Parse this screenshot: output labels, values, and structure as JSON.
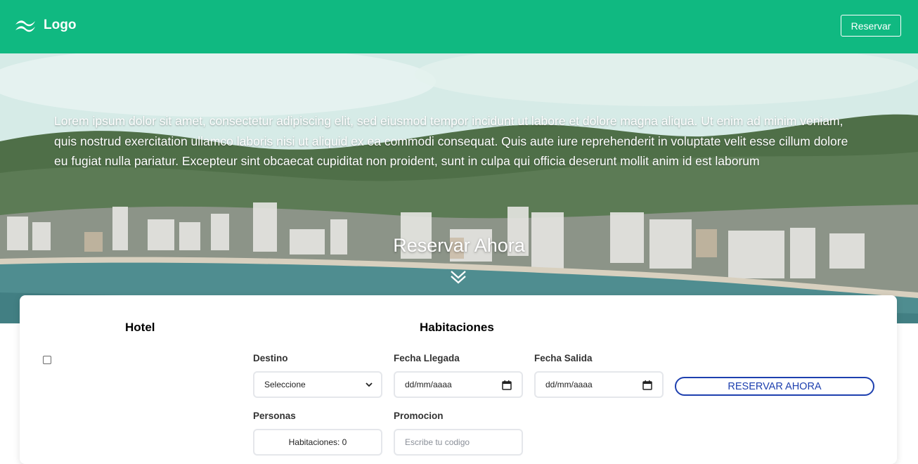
{
  "header": {
    "logo_text": "Logo",
    "reserve_button": "Reservar",
    "background_color": "#10b981"
  },
  "hero": {
    "paragraph": "Lorem ipsum dolor sit amet, consectetur adipiscing elit, sed eiusmod tempor incidunt ut labore et dolore magna aliqua. Ut enim ad minim veniam, quis nostrud exercitation ullamco laboris nisi ut aliquid ex ea commodi consequat. Quis aute iure reprehenderit in voluptate velit esse cillum dolore eu fugiat nulla pariatur. Excepteur sint obcaecat cupiditat non proident, sunt in culpa qui officia deserunt mollit anim id est laborum",
    "cta": "Reservar Ahora",
    "cta_icon": "chevron-double-down-icon"
  },
  "booking": {
    "tabs": [
      "Hotel",
      "Habitaciones"
    ],
    "destino": {
      "label": "Destino",
      "value": "Seleccione"
    },
    "fecha_llegada": {
      "label": "Fecha Llegada",
      "value": "dd/mm/aaaa"
    },
    "fecha_salida": {
      "label": "Fecha Salida",
      "value": "dd/mm/aaaa"
    },
    "personas": {
      "label": "Personas",
      "value": "Habitaciones: 0"
    },
    "promocion": {
      "label": "Promocion",
      "placeholder": "Escribe tu codigo"
    },
    "submit": "RESERVAR AHORA",
    "accent_color": "#1e40af"
  }
}
